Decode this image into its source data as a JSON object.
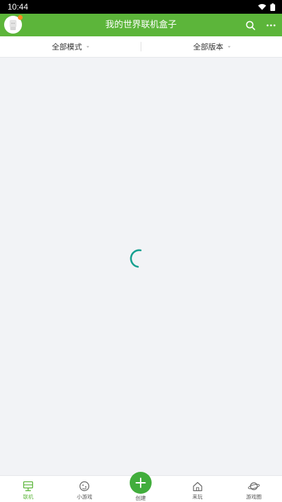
{
  "status_bar": {
    "time": "10:44",
    "icons": [
      "wifi-icon",
      "battery-icon"
    ]
  },
  "app_bar": {
    "title": "我的世界联机盒子",
    "avatar_icon": "avatar-icon",
    "actions": [
      "search-icon",
      "more-icon"
    ]
  },
  "filters": [
    {
      "label": "全部模式"
    },
    {
      "label": "全部版本"
    }
  ],
  "content": {
    "state": "loading",
    "spinner_color": "#16a090"
  },
  "bottom_nav": {
    "items": [
      {
        "label": "联机",
        "icon": "multiplayer-icon",
        "active": true
      },
      {
        "label": "小游戏",
        "icon": "mini-game-icon",
        "active": false
      },
      {
        "label": "创建",
        "icon": "plus-icon",
        "active": false
      },
      {
        "label": "来玩",
        "icon": "home-icon",
        "active": false
      },
      {
        "label": "游戏圈",
        "icon": "planet-icon",
        "active": false
      }
    ]
  },
  "colors": {
    "brand_green": "#5cb53a",
    "create_green": "#41ad3c",
    "notification_dot": "#ff8a1f"
  }
}
